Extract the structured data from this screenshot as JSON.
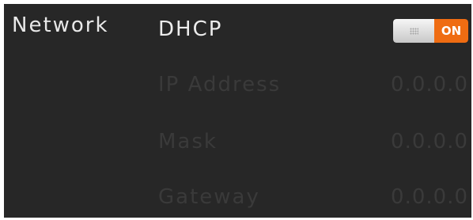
{
  "section": {
    "title": "Network"
  },
  "dhcp": {
    "label": "DHCP",
    "toggle_state": "ON",
    "enabled": true,
    "accent_color": "#EF6C12"
  },
  "fields": [
    {
      "label": "IP Address",
      "value": "0.0.0.0",
      "enabled": false
    },
    {
      "label": "Mask",
      "value": "0.0.0.0",
      "enabled": false
    },
    {
      "label": "Gateway",
      "value": "0.0.0.0",
      "enabled": false
    }
  ]
}
